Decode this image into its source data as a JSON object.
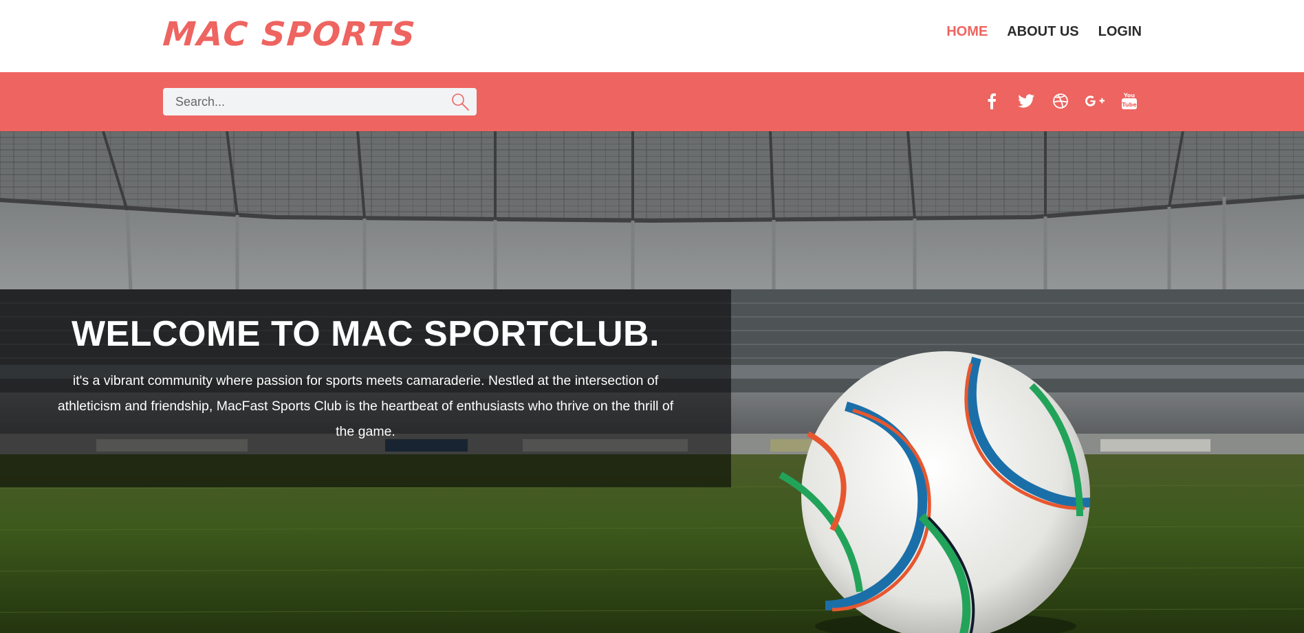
{
  "brand": {
    "name": "MAC SPORTS",
    "color": "#ee6460"
  },
  "nav": {
    "items": [
      {
        "label": "HOME",
        "active": true
      },
      {
        "label": "ABOUT US",
        "active": false
      },
      {
        "label": "LOGIN",
        "active": false
      }
    ]
  },
  "search": {
    "placeholder": "Search...",
    "value": "",
    "icon": "search-icon"
  },
  "socials": [
    {
      "icon": "facebook-icon"
    },
    {
      "icon": "twitter-icon"
    },
    {
      "icon": "dribbble-icon"
    },
    {
      "icon": "google-plus-icon"
    },
    {
      "icon": "youtube-icon"
    }
  ],
  "hero": {
    "title": "WELCOME TO MAC SPORTCLUB.",
    "description": "it's a vibrant community where passion for sports meets camaraderie. Nestled at the intersection of athleticism and friendship, MacFast Sports Club is the heartbeat of enthusiasts who thrive on the thrill of the game."
  },
  "colors": {
    "accent": "#ee6460",
    "nav_text": "#2b2b2b",
    "search_bg": "#f2f3f5"
  }
}
